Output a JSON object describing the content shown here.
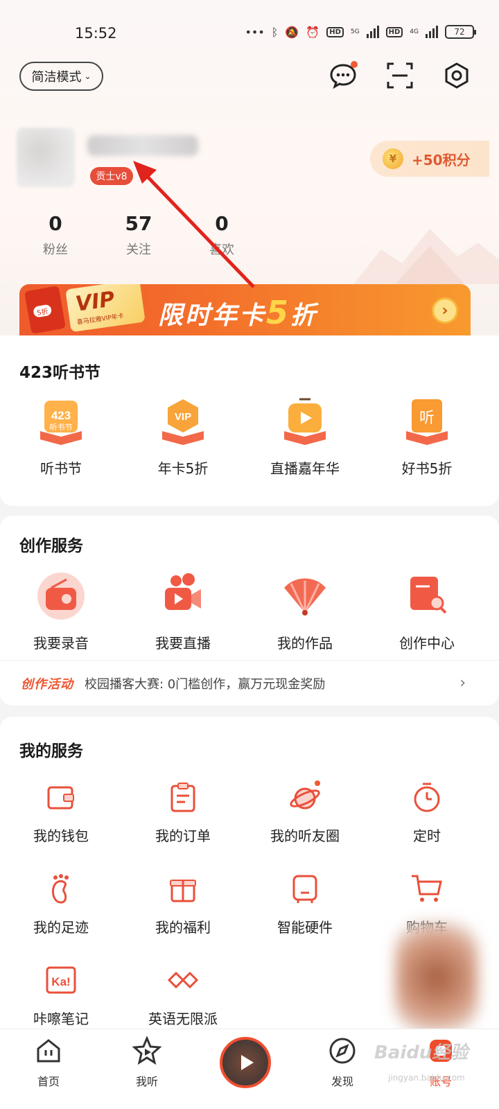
{
  "status_bar": {
    "time": "15:52",
    "battery": "72",
    "net1": "5G",
    "net2": "4G",
    "hd": "HD"
  },
  "header": {
    "mode_button": "简洁模式"
  },
  "profile": {
    "level_badge": "贡士v8",
    "points_label": "+50积分",
    "stats": [
      {
        "value": "0",
        "label": "粉丝"
      },
      {
        "value": "57",
        "label": "关注"
      },
      {
        "value": "0",
        "label": "喜欢"
      }
    ]
  },
  "vip_banner": {
    "card_text": "VIP",
    "card_sub": "喜马拉雅VIP年卡",
    "red_tag": "5折",
    "title_prefix": "限时年卡",
    "title_num": "5",
    "title_suffix": "折"
  },
  "festival": {
    "title": "423听书节",
    "items": [
      {
        "label": "听书节",
        "icon_text": "423"
      },
      {
        "label": "年卡5折",
        "icon_text": "VIP"
      },
      {
        "label": "直播嘉年华",
        "icon_text": "▶"
      },
      {
        "label": "好书5折",
        "icon_text": "听"
      }
    ]
  },
  "creation": {
    "title": "创作服务",
    "items": [
      {
        "label": "我要录音"
      },
      {
        "label": "我要直播"
      },
      {
        "label": "我的作品"
      },
      {
        "label": "创作中心"
      }
    ],
    "activity_tag": "创作活动",
    "activity_text": "校园播客大赛: 0门槛创作，赢万元现金奖励"
  },
  "services": {
    "title": "我的服务",
    "items": [
      {
        "label": "我的钱包"
      },
      {
        "label": "我的订单"
      },
      {
        "label": "我的听友圈"
      },
      {
        "label": "定时"
      },
      {
        "label": "我的足迹"
      },
      {
        "label": "我的福利"
      },
      {
        "label": "智能硬件"
      },
      {
        "label": "购物车"
      },
      {
        "label": "咔嚓笔记"
      },
      {
        "label": "英语无限派"
      }
    ]
  },
  "bottom_nav": [
    {
      "label": "首页"
    },
    {
      "label": "我听"
    },
    {
      "label": "发现"
    },
    {
      "label": "账号"
    }
  ],
  "watermark": {
    "text": "Baidu经验",
    "sub": "jingyan.baidu.com"
  },
  "colors": {
    "accent": "#ef4c2c",
    "banner_start": "#ef5b2c",
    "banner_end": "#f89a2e"
  }
}
